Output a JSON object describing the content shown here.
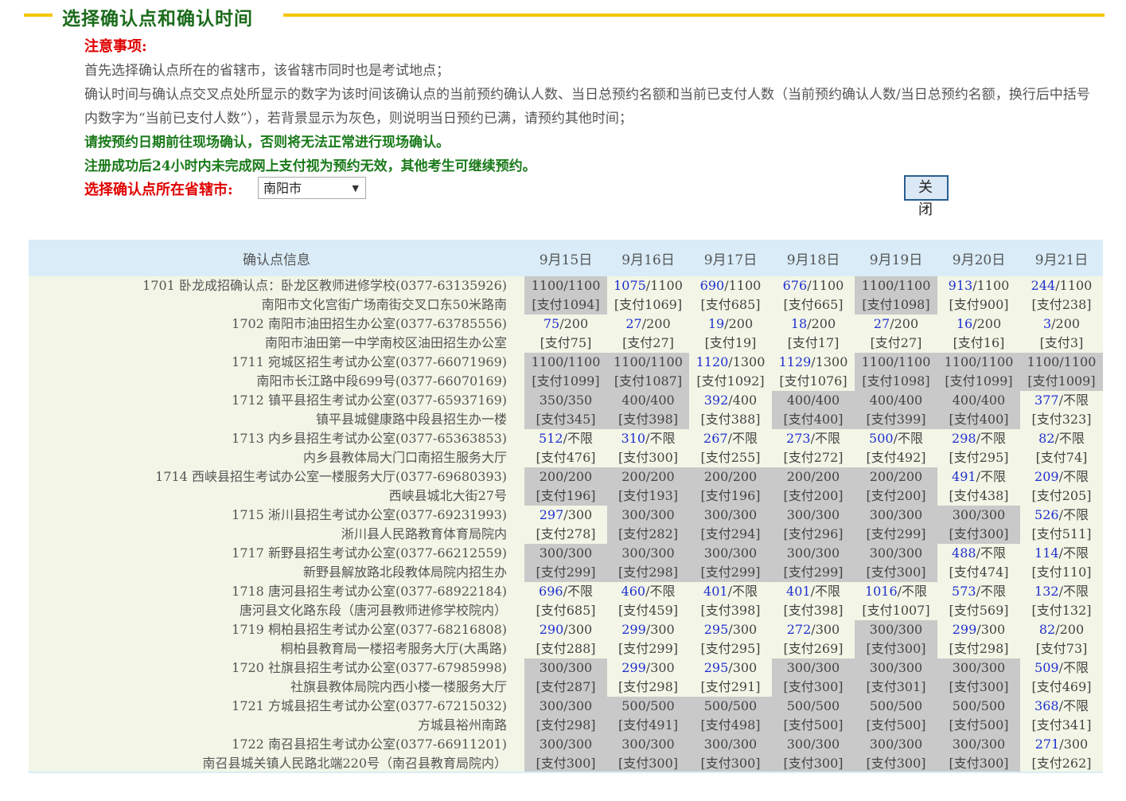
{
  "title": "选择确认点和确认时间",
  "notes": {
    "heading": "注意事项:",
    "line1": "首先选择确认点所在的省辖市，该省辖市同时也是考试地点；",
    "line2": "确认时间与确认点交叉点处所显示的数字为该时间该确认点的当前预约确认人数、当日总预约名额和当前已支付人数（当前预约确认人数/当日总预约名额，换行后中括号内数字为“当前已支付人数”），若背景显示为灰色，则说明当日预约已满，请预约其他时间；",
    "green1": "请按预约日期前往现场确认，否则将无法正常进行现场确认。",
    "green2": "注册成功后24小时内未完成网上支付视为预约无效，其他考生可继续预约。"
  },
  "select": {
    "label": "选择确认点所在省辖市:",
    "value": "南阳市"
  },
  "close_label": "关闭",
  "table": {
    "header_info": "确认点信息",
    "dates": [
      "9月15日",
      "9月16日",
      "9月17日",
      "9月18日",
      "9月19日",
      "9月20日",
      "9月21日"
    ],
    "rows": [
      {
        "line1": "1701 卧龙成招确认点：卧龙区教师进修学校(0377-63135926)",
        "line2": "南阳市文化宫街广场南街交叉口东50米路南",
        "cells": [
          {
            "a": "1100",
            "b": "1100",
            "p": "[支付1094]",
            "full": true
          },
          {
            "a": "1075",
            "b": "1100",
            "p": "[支付1069]",
            "full": false
          },
          {
            "a": "690",
            "b": "1100",
            "p": "[支付685]",
            "full": false
          },
          {
            "a": "676",
            "b": "1100",
            "p": "[支付665]",
            "full": false
          },
          {
            "a": "1100",
            "b": "1100",
            "p": "[支付1098]",
            "full": true
          },
          {
            "a": "913",
            "b": "1100",
            "p": "[支付900]",
            "full": false
          },
          {
            "a": "244",
            "b": "1100",
            "p": "[支付238]",
            "full": false
          }
        ]
      },
      {
        "line1": "1702 南阳市油田招生办公室(0377-63785556)",
        "line2": "南阳市油田第一中学南校区油田招生办公室",
        "cells": [
          {
            "a": "75",
            "b": "200",
            "p": "[支付75]",
            "full": false
          },
          {
            "a": "27",
            "b": "200",
            "p": "[支付27]",
            "full": false
          },
          {
            "a": "19",
            "b": "200",
            "p": "[支付19]",
            "full": false
          },
          {
            "a": "18",
            "b": "200",
            "p": "[支付17]",
            "full": false
          },
          {
            "a": "27",
            "b": "200",
            "p": "[支付27]",
            "full": false
          },
          {
            "a": "16",
            "b": "200",
            "p": "[支付16]",
            "full": false
          },
          {
            "a": "3",
            "b": "200",
            "p": "[支付3]",
            "full": false
          }
        ]
      },
      {
        "line1": "1711 宛城区招生考试办公室(0377-66071969)",
        "line2": "南阳市长江路中段699号(0377-66070169)",
        "cells": [
          {
            "a": "1100",
            "b": "1100",
            "p": "[支付1099]",
            "full": true
          },
          {
            "a": "1100",
            "b": "1100",
            "p": "[支付1087]",
            "full": true
          },
          {
            "a": "1120",
            "b": "1300",
            "p": "[支付1092]",
            "full": false
          },
          {
            "a": "1129",
            "b": "1300",
            "p": "[支付1076]",
            "full": false
          },
          {
            "a": "1100",
            "b": "1100",
            "p": "[支付1098]",
            "full": true
          },
          {
            "a": "1100",
            "b": "1100",
            "p": "[支付1099]",
            "full": true
          },
          {
            "a": "1100",
            "b": "1100",
            "p": "[支付1009]",
            "full": true
          }
        ]
      },
      {
        "line1": "1712 镇平县招生考试办公室(0377-65937169)",
        "line2": "镇平县城健康路中段县招生办一楼",
        "cells": [
          {
            "a": "350",
            "b": "350",
            "p": "[支付345]",
            "full": true
          },
          {
            "a": "400",
            "b": "400",
            "p": "[支付398]",
            "full": true
          },
          {
            "a": "392",
            "b": "400",
            "p": "[支付388]",
            "full": false
          },
          {
            "a": "400",
            "b": "400",
            "p": "[支付400]",
            "full": true
          },
          {
            "a": "400",
            "b": "400",
            "p": "[支付399]",
            "full": true
          },
          {
            "a": "400",
            "b": "400",
            "p": "[支付400]",
            "full": true
          },
          {
            "a": "377",
            "b": "不限",
            "p": "[支付323]",
            "full": false
          }
        ]
      },
      {
        "line1": "1713 内乡县招生考试办公室(0377-65363853)",
        "line2": "内乡县教体局大门口南招生服务大厅",
        "cells": [
          {
            "a": "512",
            "b": "不限",
            "p": "[支付476]",
            "full": false
          },
          {
            "a": "310",
            "b": "不限",
            "p": "[支付300]",
            "full": false
          },
          {
            "a": "267",
            "b": "不限",
            "p": "[支付255]",
            "full": false
          },
          {
            "a": "273",
            "b": "不限",
            "p": "[支付272]",
            "full": false
          },
          {
            "a": "500",
            "b": "不限",
            "p": "[支付492]",
            "full": false
          },
          {
            "a": "298",
            "b": "不限",
            "p": "[支付295]",
            "full": false
          },
          {
            "a": "82",
            "b": "不限",
            "p": "[支付74]",
            "full": false
          }
        ]
      },
      {
        "line1": "1714 西峡县招生考试办公室一楼服务大厅(0377-69680393)",
        "line2": "西峡县城北大街27号",
        "cells": [
          {
            "a": "200",
            "b": "200",
            "p": "[支付196]",
            "full": true
          },
          {
            "a": "200",
            "b": "200",
            "p": "[支付193]",
            "full": true
          },
          {
            "a": "200",
            "b": "200",
            "p": "[支付196]",
            "full": true
          },
          {
            "a": "200",
            "b": "200",
            "p": "[支付200]",
            "full": true
          },
          {
            "a": "200",
            "b": "200",
            "p": "[支付200]",
            "full": true
          },
          {
            "a": "491",
            "b": "不限",
            "p": "[支付438]",
            "full": false
          },
          {
            "a": "209",
            "b": "不限",
            "p": "[支付205]",
            "full": false
          }
        ]
      },
      {
        "line1": "1715 淅川县招生考试办公室(0377-69231993)",
        "line2": "淅川县人民路教育体育局院内",
        "cells": [
          {
            "a": "297",
            "b": "300",
            "p": "[支付278]",
            "full": false
          },
          {
            "a": "300",
            "b": "300",
            "p": "[支付282]",
            "full": true
          },
          {
            "a": "300",
            "b": "300",
            "p": "[支付294]",
            "full": true
          },
          {
            "a": "300",
            "b": "300",
            "p": "[支付296]",
            "full": true
          },
          {
            "a": "300",
            "b": "300",
            "p": "[支付299]",
            "full": true
          },
          {
            "a": "300",
            "b": "300",
            "p": "[支付300]",
            "full": true
          },
          {
            "a": "526",
            "b": "不限",
            "p": "[支付511]",
            "full": false
          }
        ]
      },
      {
        "line1": "1717 新野县招生考试办公室(0377-66212559)",
        "line2": "新野县解放路北段教体局院内招生办",
        "cells": [
          {
            "a": "300",
            "b": "300",
            "p": "[支付299]",
            "full": true
          },
          {
            "a": "300",
            "b": "300",
            "p": "[支付298]",
            "full": true
          },
          {
            "a": "300",
            "b": "300",
            "p": "[支付299]",
            "full": true
          },
          {
            "a": "300",
            "b": "300",
            "p": "[支付299]",
            "full": true
          },
          {
            "a": "300",
            "b": "300",
            "p": "[支付300]",
            "full": true
          },
          {
            "a": "488",
            "b": "不限",
            "p": "[支付474]",
            "full": false
          },
          {
            "a": "114",
            "b": "不限",
            "p": "[支付110]",
            "full": false
          }
        ]
      },
      {
        "line1": "1718 唐河县招生考试办公室(0377-68922184)",
        "line2": "唐河县文化路东段（唐河县教师进修学校院内）",
        "cells": [
          {
            "a": "696",
            "b": "不限",
            "p": "[支付685]",
            "full": false
          },
          {
            "a": "460",
            "b": "不限",
            "p": "[支付459]",
            "full": false
          },
          {
            "a": "401",
            "b": "不限",
            "p": "[支付398]",
            "full": false
          },
          {
            "a": "401",
            "b": "不限",
            "p": "[支付398]",
            "full": false
          },
          {
            "a": "1016",
            "b": "不限",
            "p": "[支付1007]",
            "full": false
          },
          {
            "a": "573",
            "b": "不限",
            "p": "[支付569]",
            "full": false
          },
          {
            "a": "132",
            "b": "不限",
            "p": "[支付132]",
            "full": false
          }
        ]
      },
      {
        "line1": "1719 桐柏县招生考试办公室(0377-68216808)",
        "line2": "桐柏县教育局一楼招考服务大厅(大禹路)",
        "cells": [
          {
            "a": "290",
            "b": "300",
            "p": "[支付288]",
            "full": false
          },
          {
            "a": "299",
            "b": "300",
            "p": "[支付299]",
            "full": false
          },
          {
            "a": "295",
            "b": "300",
            "p": "[支付295]",
            "full": false
          },
          {
            "a": "272",
            "b": "300",
            "p": "[支付269]",
            "full": false
          },
          {
            "a": "300",
            "b": "300",
            "p": "[支付300]",
            "full": true
          },
          {
            "a": "299",
            "b": "300",
            "p": "[支付298]",
            "full": false
          },
          {
            "a": "82",
            "b": "200",
            "p": "[支付73]",
            "full": false
          }
        ]
      },
      {
        "line1": "1720 社旗县招生考试办公室(0377-67985998)",
        "line2": "社旗县教体局院内西小楼一楼服务大厅",
        "cells": [
          {
            "a": "300",
            "b": "300",
            "p": "[支付287]",
            "full": true
          },
          {
            "a": "299",
            "b": "300",
            "p": "[支付298]",
            "full": false
          },
          {
            "a": "295",
            "b": "300",
            "p": "[支付291]",
            "full": false
          },
          {
            "a": "300",
            "b": "300",
            "p": "[支付300]",
            "full": true
          },
          {
            "a": "300",
            "b": "300",
            "p": "[支付301]",
            "full": true
          },
          {
            "a": "300",
            "b": "300",
            "p": "[支付300]",
            "full": true
          },
          {
            "a": "509",
            "b": "不限",
            "p": "[支付469]",
            "full": false
          }
        ]
      },
      {
        "line1": "1721 方城县招生考试办公室(0377-67215032)",
        "line2": "方城县裕州南路",
        "cells": [
          {
            "a": "300",
            "b": "300",
            "p": "[支付298]",
            "full": true
          },
          {
            "a": "500",
            "b": "500",
            "p": "[支付491]",
            "full": true
          },
          {
            "a": "500",
            "b": "500",
            "p": "[支付498]",
            "full": true
          },
          {
            "a": "500",
            "b": "500",
            "p": "[支付500]",
            "full": true
          },
          {
            "a": "500",
            "b": "500",
            "p": "[支付500]",
            "full": true
          },
          {
            "a": "500",
            "b": "500",
            "p": "[支付500]",
            "full": true
          },
          {
            "a": "368",
            "b": "不限",
            "p": "[支付341]",
            "full": false
          }
        ]
      },
      {
        "line1": "1722 南召县招生考试办公室(0377-66911201)",
        "line2": "南召县城关镇人民路北端220号（南召县教育局院内）",
        "cells": [
          {
            "a": "300",
            "b": "300",
            "p": "[支付300]",
            "full": true
          },
          {
            "a": "300",
            "b": "300",
            "p": "[支付300]",
            "full": true
          },
          {
            "a": "300",
            "b": "300",
            "p": "[支付300]",
            "full": true
          },
          {
            "a": "300",
            "b": "300",
            "p": "[支付300]",
            "full": true
          },
          {
            "a": "300",
            "b": "300",
            "p": "[支付300]",
            "full": true
          },
          {
            "a": "300",
            "b": "300",
            "p": "[支付300]",
            "full": true
          },
          {
            "a": "271",
            "b": "300",
            "p": "[支付262]",
            "full": false
          }
        ]
      }
    ]
  }
}
